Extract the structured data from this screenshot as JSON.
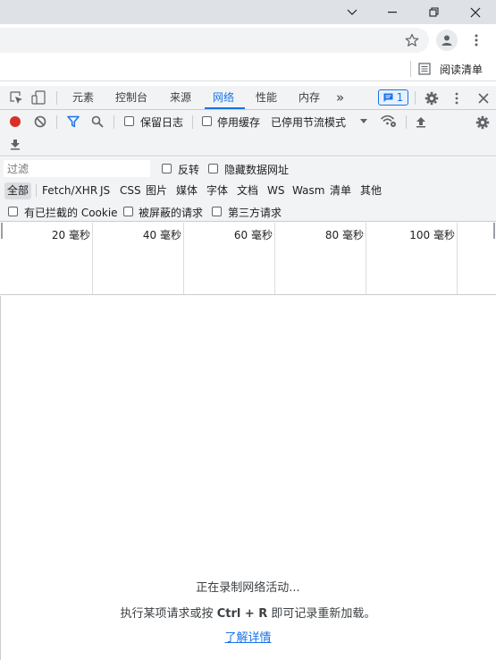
{
  "window": {
    "minimize_icon": "chevron-down-icon",
    "maximize_icon": "minus-icon",
    "restore_icon": "restore-icon",
    "close_icon": "close-icon"
  },
  "bookmarks": {
    "reading_list": "阅读清单"
  },
  "devtools": {
    "tabs": [
      "元素",
      "控制台",
      "来源",
      "网络",
      "性能",
      "内存"
    ],
    "active_tab": "网络",
    "more_tabs": "»",
    "issues_count": "1"
  },
  "network": {
    "preserve_log": "保留日志",
    "disable_cache": "停用缓存",
    "throttling": "已停用节流模式"
  },
  "filter": {
    "placeholder": "过滤",
    "invert": "反转",
    "hide_data_urls": "隐藏数据网址",
    "types": [
      "全部",
      "Fetch/XHR",
      "JS",
      "CSS",
      "图片",
      "媒体",
      "字体",
      "文档",
      "WS",
      "Wasm",
      "清单",
      "其他"
    ],
    "active_type": "全部",
    "blocked_cookies": "有已拦截的 Cookie",
    "blocked_requests": "被屏蔽的请求",
    "third_party": "第三方请求"
  },
  "timeline": {
    "ticks": [
      "20 毫秒",
      "40 毫秒",
      "60 毫秒",
      "80 毫秒",
      "100 毫秒"
    ]
  },
  "empty_state": {
    "recording": "正在录制网络活动...",
    "hint_prefix": "执行某项请求或按",
    "hint_keys": "Ctrl + R",
    "hint_suffix": "即可记录重新加载。",
    "learn_more": "了解详情"
  },
  "colors": {
    "accent": "#1a73e8",
    "record": "#d93025"
  }
}
